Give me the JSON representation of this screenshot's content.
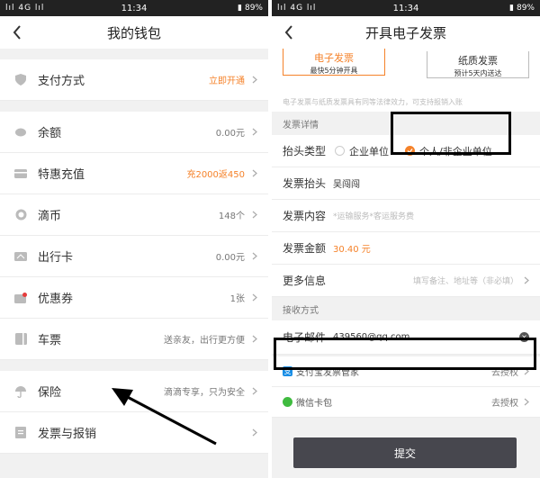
{
  "status": {
    "carrier": "lıl 4G lıl",
    "time": "11:34",
    "battery": "89%"
  },
  "wallet": {
    "title": "我的钱包",
    "items": [
      {
        "label": "支付方式",
        "value": "立即开通",
        "value_color": "orange",
        "icon": "shield-icon"
      },
      {
        "label": "余额",
        "value": "0.00元",
        "icon": "piggy-bank-icon"
      },
      {
        "label": "特惠充值",
        "value": "充2000返450",
        "value_color": "orange",
        "icon": "card-icon"
      },
      {
        "label": "滴币",
        "value": "148个",
        "icon": "coin-icon"
      },
      {
        "label": "出行卡",
        "value": "0.00元",
        "icon": "travel-card-icon"
      },
      {
        "label": "优惠券",
        "value": "1张",
        "icon": "coupon-icon"
      },
      {
        "label": "车票",
        "value": "送亲友，出行更方便",
        "icon": "ticket-icon"
      },
      {
        "label": "保险",
        "value": "滴滴专享，只为安全",
        "icon": "umbrella-icon"
      },
      {
        "label": "发票与报销",
        "value": "",
        "icon": "invoice-icon"
      }
    ]
  },
  "invoice": {
    "title": "开具电子发票",
    "tabs": [
      {
        "label": "电子发票",
        "sub": "最快5分钟开具"
      },
      {
        "label": "纸质发票",
        "sub": "预计5天内送达"
      }
    ],
    "note": "电子发票与纸质发票具有同等法律效力，可支持报销入账",
    "section_detail": "发票详情",
    "type_label": "抬头类型",
    "type_options": [
      "企业单位",
      "个人/非企业单位"
    ],
    "head_label": "发票抬头",
    "head_value": "吴闯闯",
    "content_label": "发票内容",
    "content_value": "*运输服务*客运服务费",
    "amount_label": "发票金额",
    "amount_value": "30.40 元",
    "more_label": "更多信息",
    "more_placeholder": "填写备注、地址等（非必填）",
    "section_receive": "接收方式",
    "email_label": "电子邮件",
    "email_value": "439560@qq.com",
    "alipay_label": "支付宝发票管家",
    "alipay_action": "去授权",
    "wechat_label": "微信卡包",
    "wechat_action": "去授权",
    "submit": "提交"
  },
  "colors": {
    "accent": "#f5822a",
    "submit_bg": "#47474e"
  }
}
